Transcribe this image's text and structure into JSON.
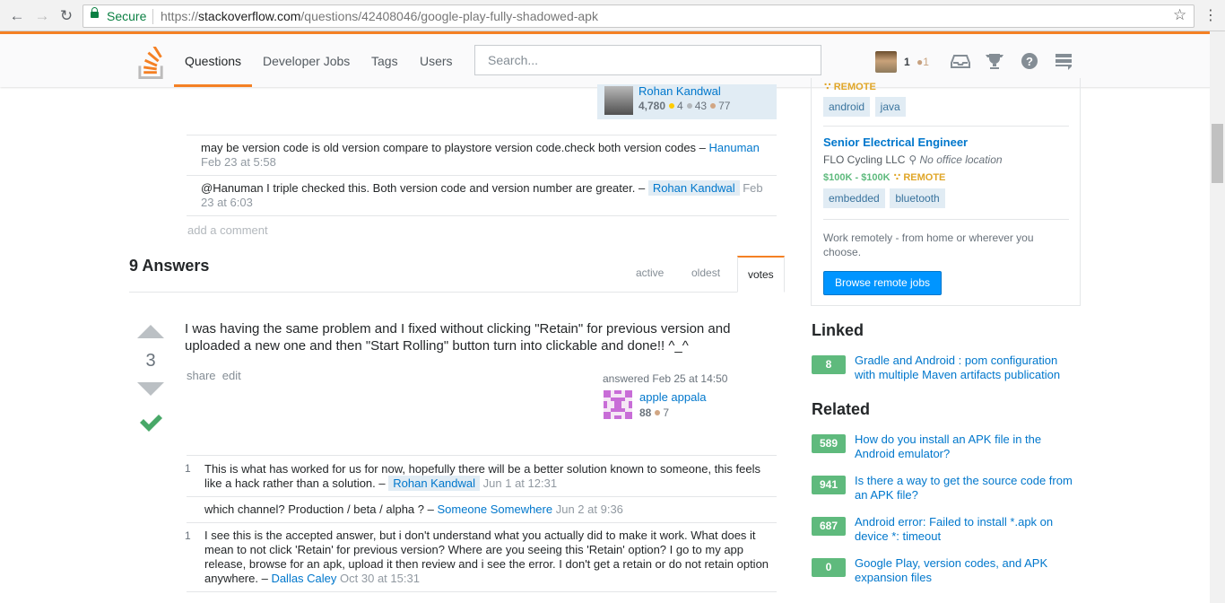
{
  "browser": {
    "secure_label": "Secure",
    "url_scheme": "https://",
    "url_host": "stackoverflow.com",
    "url_path": "/questions/42408046/google-play-fully-shadowed-apk"
  },
  "topbar": {
    "nav": [
      "Questions",
      "Developer Jobs",
      "Tags",
      "Users"
    ],
    "search_placeholder": "Search...",
    "reputation": "1",
    "bronze_badges": "1",
    "accent_color": "#f48024"
  },
  "question_owner": {
    "name": "Rohan Kandwal",
    "reputation": "4,780",
    "gold": "4",
    "silver": "43",
    "bronze": "77"
  },
  "question_comments": [
    {
      "text": "may be version code is old version compare to playstore version code.check both version codes – ",
      "user": "Hanuman",
      "time": "Feb 23 at 5:58"
    },
    {
      "text": "@Hanuman I triple checked this. Both version code and version number are greater. – ",
      "user": "Rohan Kandwal",
      "time": "Feb 23 at 6:03"
    }
  ],
  "add_comment_label": "add a comment",
  "answers": {
    "title": "9 Answers",
    "sort_tabs": [
      "active",
      "oldest",
      "votes"
    ],
    "active_sort": "votes"
  },
  "answer": {
    "votes": "3",
    "body": "I was having the same problem and I fixed without clicking \"Retain\" for previous version and uploaded a new one and then \"Start Rolling\" button turn into clickable and done!! ^_^",
    "menu": [
      "share",
      "edit"
    ],
    "answered_time": "answered Feb 25 at 14:50",
    "user": "apple appala",
    "reputation": "88",
    "bronze": "7",
    "accepted": true,
    "comments": [
      {
        "score": "1",
        "text": "This is what has worked for us for now, hopefully there will be a better solution known to someone, this feels like a hack rather than a solution. – ",
        "user": "Rohan Kandwal",
        "time": "Jun 1 at 12:31"
      },
      {
        "score": "",
        "text": "which channel? Production / beta / alpha ? – ",
        "user": "Someone Somewhere",
        "time": "Jun 2 at 9:36"
      },
      {
        "score": "1",
        "text": "I see this is the accepted answer, but i don't understand what you actually did to make it work. What does it mean to not click 'Retain' for previous version? Where are you seeing this 'Retain' option? I go to my app release, browse for an apk, upload it then review and i see the error. I don't get a retain or do not retain option anywhere. – ",
        "user": "Dallas Caley",
        "time": "Oct 30 at 15:31"
      }
    ]
  },
  "jobs": {
    "remote_label_top": "REMOTE",
    "tags_first": [
      "android",
      "java"
    ],
    "job": {
      "title": "Senior Electrical Engineer",
      "company": "FLO Cycling LLC",
      "location": "No office location",
      "salary": "$100K - $100K",
      "remote": "REMOTE",
      "tags": [
        "embedded",
        "bluetooth"
      ]
    },
    "work_remote_text": "Work remotely - from home or wherever you choose.",
    "browse_button": "Browse remote jobs"
  },
  "linked": {
    "title": "Linked",
    "items": [
      {
        "score": "8",
        "title": "Gradle and Android : pom configuration with multiple Maven artifacts publication"
      }
    ]
  },
  "related": {
    "title": "Related",
    "items": [
      {
        "score": "589",
        "title": "How do you install an APK file in the Android emulator?"
      },
      {
        "score": "941",
        "title": "Is there a way to get the source code from an APK file?"
      },
      {
        "score": "687",
        "title": "Android error: Failed to install *.apk on device *: timeout"
      },
      {
        "score": "0",
        "title": "Google Play, version codes, and APK expansion files"
      }
    ]
  }
}
